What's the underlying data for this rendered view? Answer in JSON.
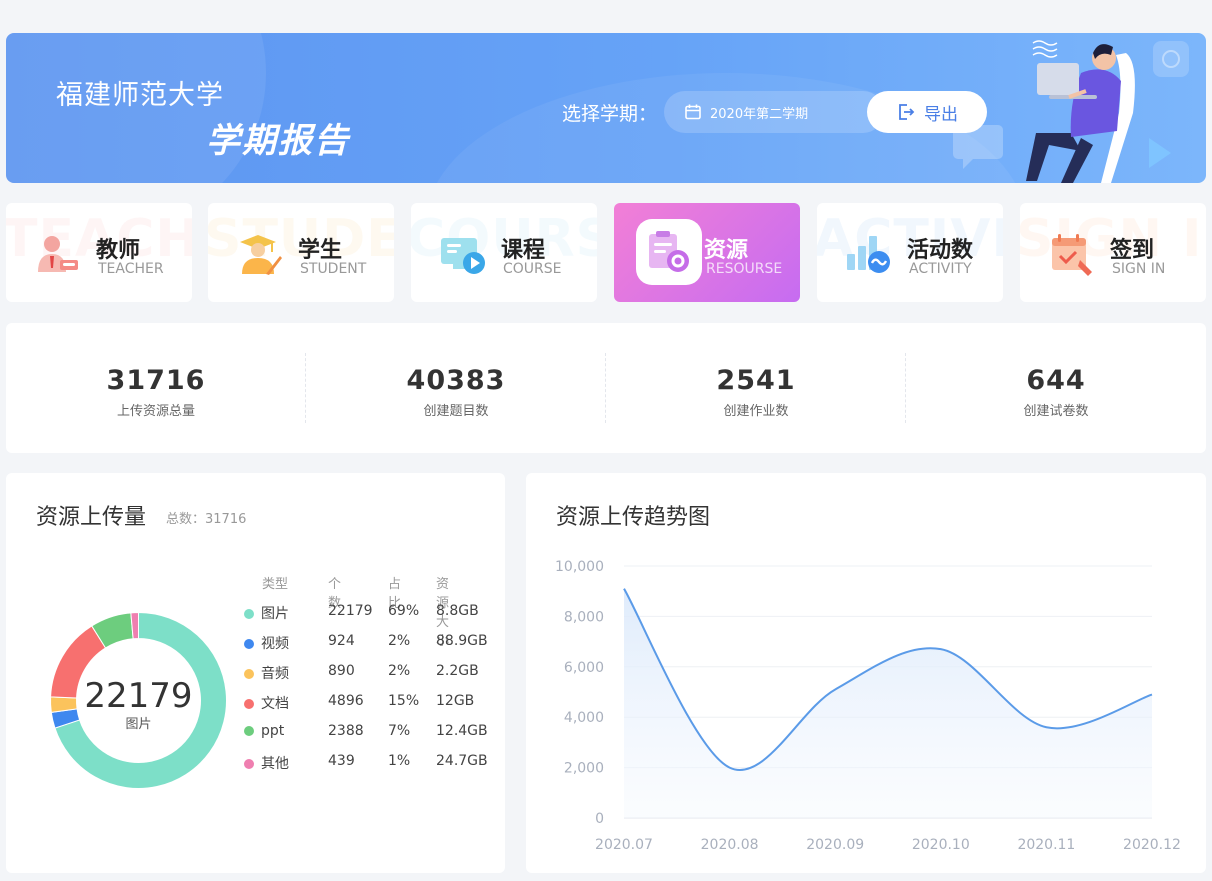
{
  "banner": {
    "school": "福建师范大学",
    "report_title": "学期报告",
    "term_label": "选择学期：",
    "term_value": "2020年第二学期",
    "export_label": "导出"
  },
  "categories": [
    {
      "cn": "教师",
      "en": "TEACHER",
      "ghost": "TEACHER",
      "icon": "teacher-icon",
      "active": false
    },
    {
      "cn": "学生",
      "en": "STUDENT",
      "ghost": "STUDENT",
      "icon": "student-icon",
      "active": false
    },
    {
      "cn": "课程",
      "en": "COURSE",
      "ghost": "COURSE",
      "icon": "course-icon",
      "active": false
    },
    {
      "cn": "资源",
      "en": "RESOURSE",
      "ghost": "RESOURSE",
      "icon": "resource-icon",
      "active": true
    },
    {
      "cn": "活动数",
      "en": "ACTIVITY",
      "ghost": "ACTIVITY",
      "icon": "activity-icon",
      "active": false
    },
    {
      "cn": "签到",
      "en": "SIGN IN",
      "ghost": "SIGN IN",
      "icon": "signin-icon",
      "active": false
    }
  ],
  "stats": [
    {
      "value": "31716",
      "label": "上传资源总量"
    },
    {
      "value": "40383",
      "label": "创建题目数"
    },
    {
      "value": "2541",
      "label": "创建作业数"
    },
    {
      "value": "644",
      "label": "创建试卷数"
    }
  ],
  "upload_panel": {
    "title": "资源上传量",
    "total": "总数：31716",
    "center_value": "22179",
    "center_label": "图片",
    "headers": [
      "类型",
      "个数",
      "占比",
      "资源大小"
    ],
    "rows": [
      {
        "type": "图片",
        "count": "22179",
        "pct": "69%",
        "size": "8.8GB",
        "color": "#7ddfc8"
      },
      {
        "type": "视频",
        "count": "924",
        "pct": "2%",
        "size": "88.9GB",
        "color": "#3f88ef"
      },
      {
        "type": "音频",
        "count": "890",
        "pct": "2%",
        "size": "2.2GB",
        "color": "#fbc35c"
      },
      {
        "type": "文档",
        "count": "4896",
        "pct": "15%",
        "size": "12GB",
        "color": "#f7706f"
      },
      {
        "type": "ppt",
        "count": "2388",
        "pct": "7%",
        "size": "12.4GB",
        "color": "#6dcd7e"
      },
      {
        "type": "其他",
        "count": "439",
        "pct": "1%",
        "size": "24.7GB",
        "color": "#ef7fb0"
      }
    ]
  },
  "trend_panel": {
    "title": "资源上传趋势图"
  },
  "chart_data": {
    "type": "area",
    "x": [
      "2020.07",
      "2020.08",
      "2020.09",
      "2020.10",
      "2020.11",
      "2020.12"
    ],
    "values": [
      9100,
      2000,
      5100,
      6700,
      3600,
      4900
    ],
    "yticks": [
      "0",
      "2,000",
      "4,000",
      "6,000",
      "8,000",
      "10,000"
    ],
    "ylim": [
      0,
      10000
    ],
    "line_color": "#5b9be8",
    "grid": true
  }
}
